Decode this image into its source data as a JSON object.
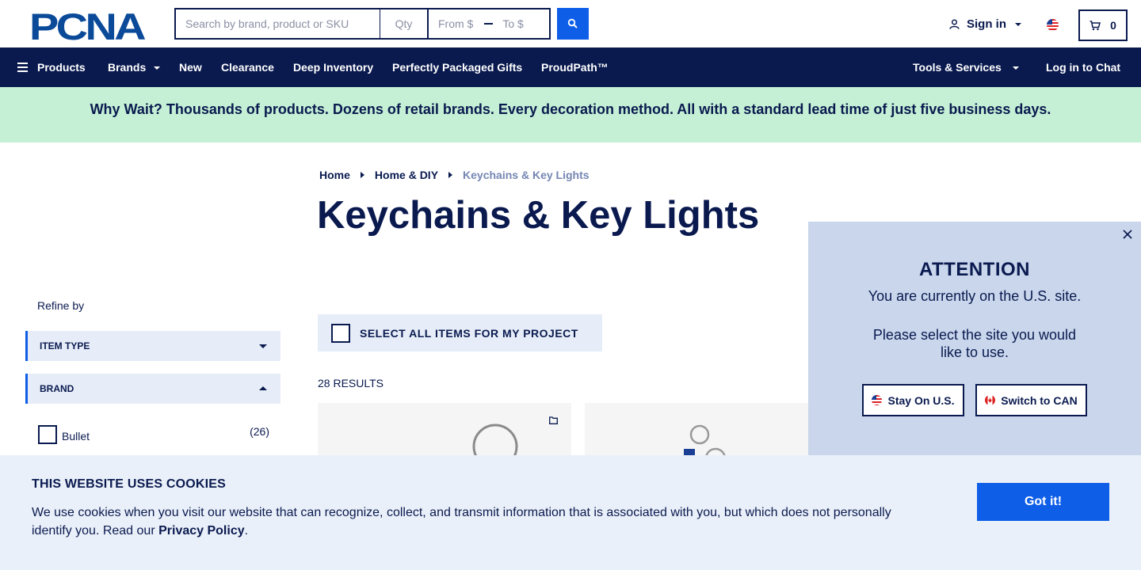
{
  "header": {
    "logo_text": "PCNA",
    "search_placeholder": "Search by brand, product or SKU",
    "qty_placeholder": "Qty",
    "from_placeholder": "From $",
    "to_placeholder": "To $",
    "signin_label": "Sign in",
    "cart_count": "0"
  },
  "nav": {
    "products": "Products",
    "brands": "Brands",
    "new": "New",
    "clearance": "Clearance",
    "deep_inventory": "Deep Inventory",
    "gifts": "Perfectly Packaged Gifts",
    "proudpath": "ProudPath™",
    "tools": "Tools & Services",
    "chat": "Log in to Chat"
  },
  "promo": {
    "text": "Why Wait? Thousands of products. Dozens of retail brands. Every decoration method. All with a standard lead time of just five business days."
  },
  "breadcrumb": {
    "home": "Home",
    "category": "Home & DIY",
    "current": "Keychains & Key Lights"
  },
  "page": {
    "title": "Keychains & Key Lights",
    "select_all": "SELECT ALL ITEMS FOR MY PROJECT",
    "results": "28 RESULTS"
  },
  "sidebar": {
    "refine_label": "Refine by",
    "facets": [
      {
        "label": "ITEM TYPE",
        "expanded": false
      },
      {
        "label": "BRAND",
        "expanded": true
      }
    ],
    "brand_options": [
      {
        "label": "Bullet",
        "count": "(26)"
      }
    ]
  },
  "modal": {
    "title": "ATTENTION",
    "line1": "You are currently on the U.S. site.",
    "line2": "Please select the site you would like to use.",
    "stay_label": "Stay On U.S.",
    "switch_label": "Switch to CAN"
  },
  "cookie": {
    "title": "THIS WEBSITE USES COOKIES",
    "text": "We use cookies when you visit our website that can recognize, collect, and transmit information that is associated with you, but which does not personally identify you. Read our ",
    "link": "Privacy Policy",
    "end": ".",
    "button": "Got it!"
  },
  "colors": {
    "navy": "#0a1a4f",
    "blue": "#0e5ee8",
    "promo_bg": "#c5f0d5",
    "panel_bg": "#e6edf8",
    "modal_bg": "#c9d6ec"
  }
}
